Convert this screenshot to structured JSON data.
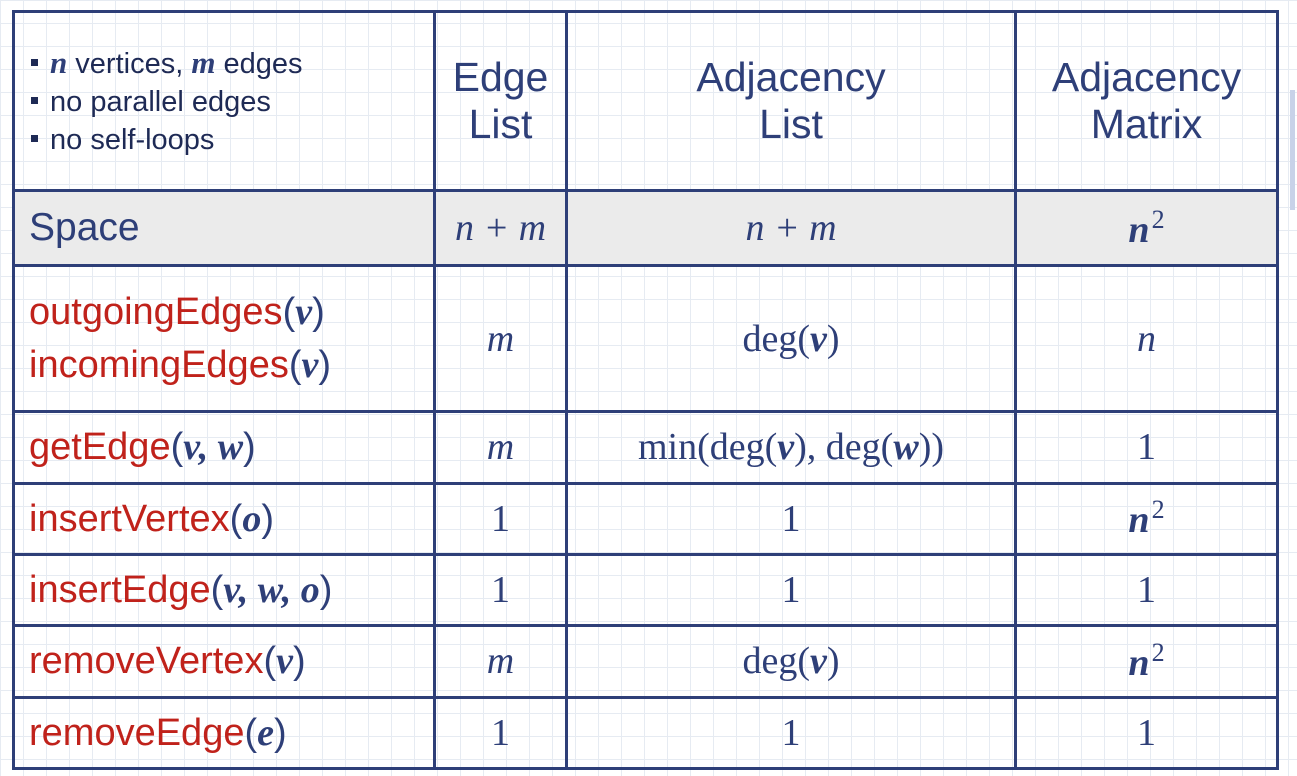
{
  "notes": [
    {
      "var1": "n",
      "text1": " vertices, ",
      "var2": "m",
      "text2": " edges"
    },
    {
      "text": "no parallel edges"
    },
    {
      "text": "no self-loops"
    }
  ],
  "headers": {
    "edge_list": [
      "Edge",
      "List"
    ],
    "adjacency_list": [
      "Adjacency",
      "List"
    ],
    "adjacency_matrix": [
      "Adjacency",
      "Matrix"
    ]
  },
  "space": {
    "label": "Space",
    "edge_list": "n + m",
    "adjacency_list": "n + m",
    "adjacency_matrix": {
      "base": "n",
      "exp": "2"
    }
  },
  "rows": {
    "edges": {
      "op1": {
        "name": "outgoingEdges",
        "args": "v"
      },
      "op2": {
        "name": "incomingEdges",
        "args": "v"
      },
      "edge_list": "m",
      "adjacency_list": {
        "pre": "deg(",
        "var": "v",
        "post": ")"
      },
      "adjacency_matrix": "n"
    },
    "get_edge": {
      "op": {
        "name": "getEdge",
        "args": "v, w"
      },
      "edge_list": "m",
      "adjacency_list": {
        "p1": "min(deg(",
        "v1": "v",
        "p2": "), deg(",
        "v2": "w",
        "p3": "))"
      },
      "adjacency_matrix": "1"
    },
    "insert_vertex": {
      "op": {
        "name": "insertVertex",
        "args": "o"
      },
      "edge_list": "1",
      "adjacency_list": "1",
      "adjacency_matrix": {
        "base": "n",
        "exp": "2"
      }
    },
    "insert_edge": {
      "op": {
        "name": "insertEdge",
        "args": "v, w, o"
      },
      "edge_list": "1",
      "adjacency_list": "1",
      "adjacency_matrix": "1"
    },
    "remove_vertex": {
      "op": {
        "name": "removeVertex",
        "args": "v"
      },
      "edge_list": "m",
      "adjacency_list": {
        "pre": "deg(",
        "var": "v",
        "post": ")"
      },
      "adjacency_matrix": {
        "base": "n",
        "exp": "2"
      }
    },
    "remove_edge": {
      "op": {
        "name": "removeEdge",
        "args": "e"
      },
      "edge_list": "1",
      "adjacency_list": "1",
      "adjacency_matrix": "1"
    }
  },
  "paren_open": "(",
  "paren_close": ")",
  "colors": {
    "operation": "#c0221b",
    "text": "#2e3f78",
    "border": "#2e3f78",
    "space_row_bg": "#ebebeb"
  }
}
